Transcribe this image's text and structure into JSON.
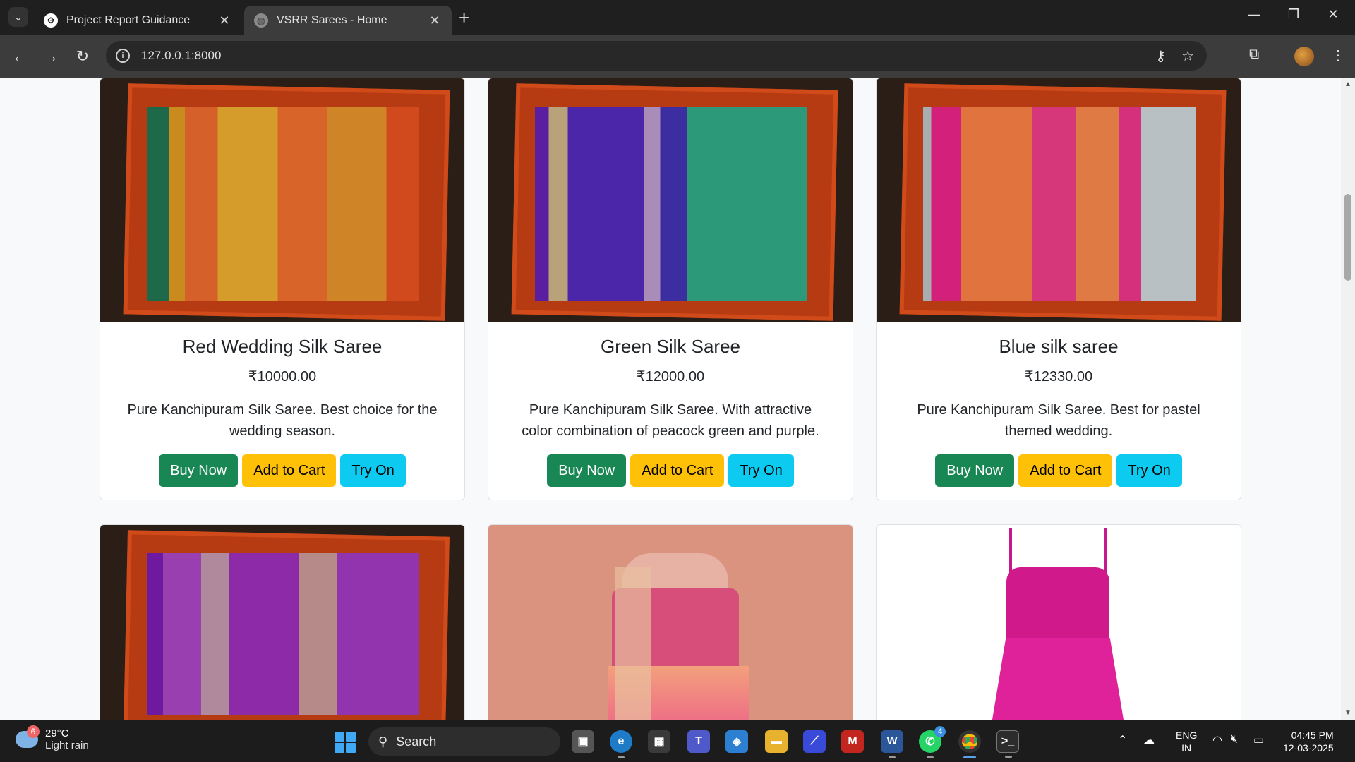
{
  "browser": {
    "tabs": [
      {
        "title": "Project Report Guidance",
        "active": false
      },
      {
        "title": "VSRR Sarees - Home",
        "active": true
      }
    ],
    "url": "127.0.0.1:8000"
  },
  "products": [
    {
      "name": "Red Wedding Silk Saree",
      "price": "₹10000.00",
      "description": "Pure Kanchipuram Silk Saree. Best choice for the wedding season.",
      "image": "red-gold-silk-saree-in-box"
    },
    {
      "name": "Green Silk Saree",
      "price": "₹12000.00",
      "description": "Pure Kanchipuram Silk Saree. With attractive color combination of peacock green and purple.",
      "image": "purple-green-silk-saree-in-box"
    },
    {
      "name": "Blue silk saree",
      "price": "₹12330.00",
      "description": "Pure Kanchipuram Silk Saree. Best for pastel themed wedding.",
      "image": "pink-silver-silk-saree-in-box"
    },
    {
      "image": "purple-silk-saree-in-box"
    },
    {
      "image": "pink-embroidered-lehenga"
    },
    {
      "image": "magenta-dress"
    }
  ],
  "buttons": {
    "buy": "Buy Now",
    "cart": "Add to Cart",
    "try": "Try On"
  },
  "colors": {
    "buy": "#198754",
    "cart": "#ffc107",
    "try": "#0dcaf0"
  },
  "taskbar": {
    "weather_temp": "29°C",
    "weather_desc": "Light rain",
    "weather_badge": "6",
    "search_label": "Search",
    "whatsapp_badge": "4",
    "lang_line1": "ENG",
    "lang_line2": "IN",
    "time": "04:45 PM",
    "date": "12-03-2025"
  }
}
